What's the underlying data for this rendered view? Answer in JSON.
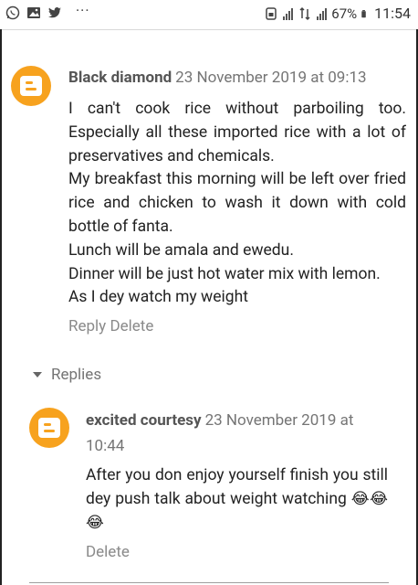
{
  "status_bar": {
    "left_icons": [
      "whatsapp-icon",
      "image-icon",
      "twitter-icon",
      "more-dots-icon"
    ],
    "more_dots": "···",
    "battery_percent": "67%",
    "time": "11:54"
  },
  "comment": {
    "author": "Black diamond",
    "date": "23 November 2019 at 09:13",
    "paragraphs": [
      "I can't cook rice without parboiling too. Especially all these imported rice with a lot of preservatives and chemicals.",
      "My breakfast this morning will be left over fried rice and chicken to wash it down with cold bottle of fanta.",
      "Lunch will be amala and ewedu.",
      "Dinner will be just hot water mix with lemon.",
      "As I dey watch my weight"
    ],
    "reply_label": "Reply",
    "delete_label": "Delete"
  },
  "replies_toggle": "Replies",
  "reply": {
    "author": "excited courtesy",
    "date": "23 November 2019 at 10:44",
    "text": "After you don enjoy yourself finish you still dey push talk about weight watching",
    "emoji": "😂😂😂",
    "delete_label": "Delete"
  },
  "colors": {
    "avatar": "#f7a21e",
    "author": "#555555",
    "meta": "#757575"
  }
}
